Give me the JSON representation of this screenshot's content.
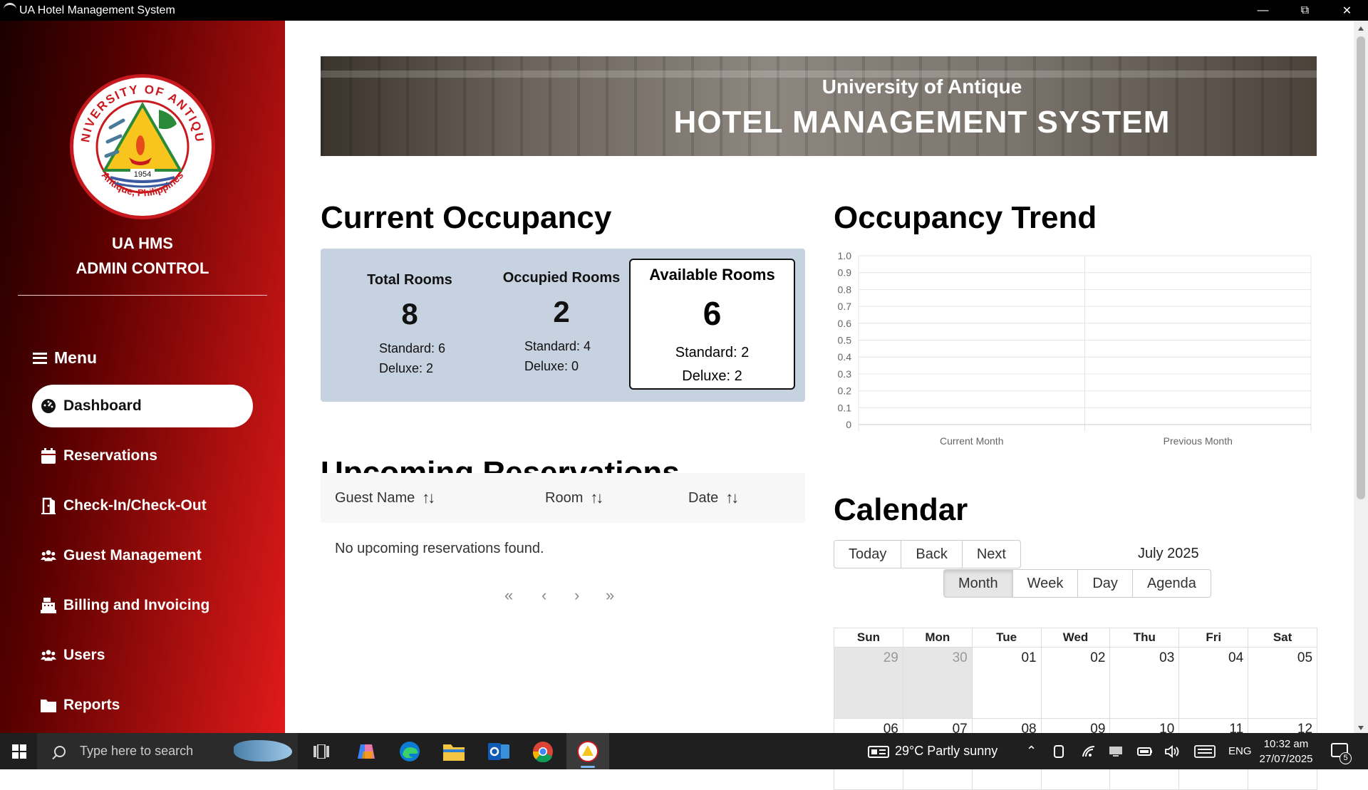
{
  "window": {
    "title": "UA Hotel Management System",
    "minimize_icon": "minimize-icon",
    "restore_icon": "restore-icon",
    "close_icon": "close-icon"
  },
  "sidebar": {
    "logo": {
      "ring_text_top": "UNIVERSITY OF ANTIQUE",
      "ring_text_bottom": "Antique, Philippines",
      "year": "1954"
    },
    "brand_line1": "UA HMS",
    "brand_line2": "ADMIN CONTROL",
    "menu_label": "Menu",
    "items": [
      {
        "label": "Dashboard",
        "icon": "dashboard-gauge-icon",
        "active": true
      },
      {
        "label": "Reservations",
        "icon": "calendar-icon",
        "active": false
      },
      {
        "label": "Check-In/Check-Out",
        "icon": "door-open-icon",
        "active": false
      },
      {
        "label": "Guest Management",
        "icon": "people-group-icon",
        "active": false
      },
      {
        "label": "Billing and Invoicing",
        "icon": "cash-register-icon",
        "active": false
      },
      {
        "label": "Users",
        "icon": "users-icon",
        "active": false
      },
      {
        "label": "Reports",
        "icon": "folder-icon",
        "active": false
      }
    ]
  },
  "banner": {
    "line1": "University of Antique",
    "line2": "HOTEL MANAGEMENT SYSTEM"
  },
  "occupancy": {
    "title": "Current Occupancy",
    "total": {
      "label": "Total Rooms",
      "value": "8",
      "standard": "Standard: 6",
      "deluxe": "Deluxe: 2"
    },
    "occupied": {
      "label": "Occupied Rooms",
      "value": "2",
      "standard": "Standard: 4",
      "deluxe": "Deluxe: 0"
    },
    "available": {
      "label": "Available Rooms",
      "value": "6",
      "standard": "Standard: 2",
      "deluxe": "Deluxe: 2"
    }
  },
  "reservations": {
    "title": "Upcoming Reservations",
    "columns": [
      "Guest Name",
      "Room",
      "Date"
    ],
    "empty_text": "No upcoming reservations found.",
    "pager": [
      "«",
      "‹",
      "›",
      "»"
    ]
  },
  "trend": {
    "title": "Occupancy Trend"
  },
  "chart_data": {
    "type": "bar",
    "categories": [
      "Current Month",
      "Previous Month"
    ],
    "values": [
      0,
      0
    ],
    "title": "",
    "xlabel": "",
    "ylabel": "",
    "ylim": [
      0,
      1.0
    ],
    "yticks": [
      "0",
      "0.1",
      "0.2",
      "0.3",
      "0.4",
      "0.5",
      "0.6",
      "0.7",
      "0.8",
      "0.9",
      "1.0"
    ],
    "grid": true
  },
  "calendar": {
    "title": "Calendar",
    "nav_buttons": [
      "Today",
      "Back",
      "Next"
    ],
    "month_label": "July 2025",
    "view_buttons": [
      "Month",
      "Week",
      "Day",
      "Agenda"
    ],
    "active_view": "Month",
    "weekdays": [
      "Sun",
      "Mon",
      "Tue",
      "Wed",
      "Thu",
      "Fri",
      "Sat"
    ],
    "weeks": [
      [
        "29",
        "30",
        "01",
        "02",
        "03",
        "04",
        "05"
      ],
      [
        "06",
        "07",
        "08",
        "09",
        "10",
        "11",
        "12"
      ]
    ],
    "off_days": [
      "29",
      "30"
    ]
  },
  "taskbar": {
    "search_placeholder": "Type here to search",
    "apps": [
      "task-view-icon",
      "copilot-icon",
      "edge-icon",
      "file-explorer-icon",
      "outlook-icon",
      "chrome-icon",
      "ua-hms-app-icon"
    ],
    "weather": "29°C  Partly sunny",
    "language": "ENG",
    "time": "10:32 am",
    "date": "27/07/2025",
    "notification_count": "5"
  }
}
